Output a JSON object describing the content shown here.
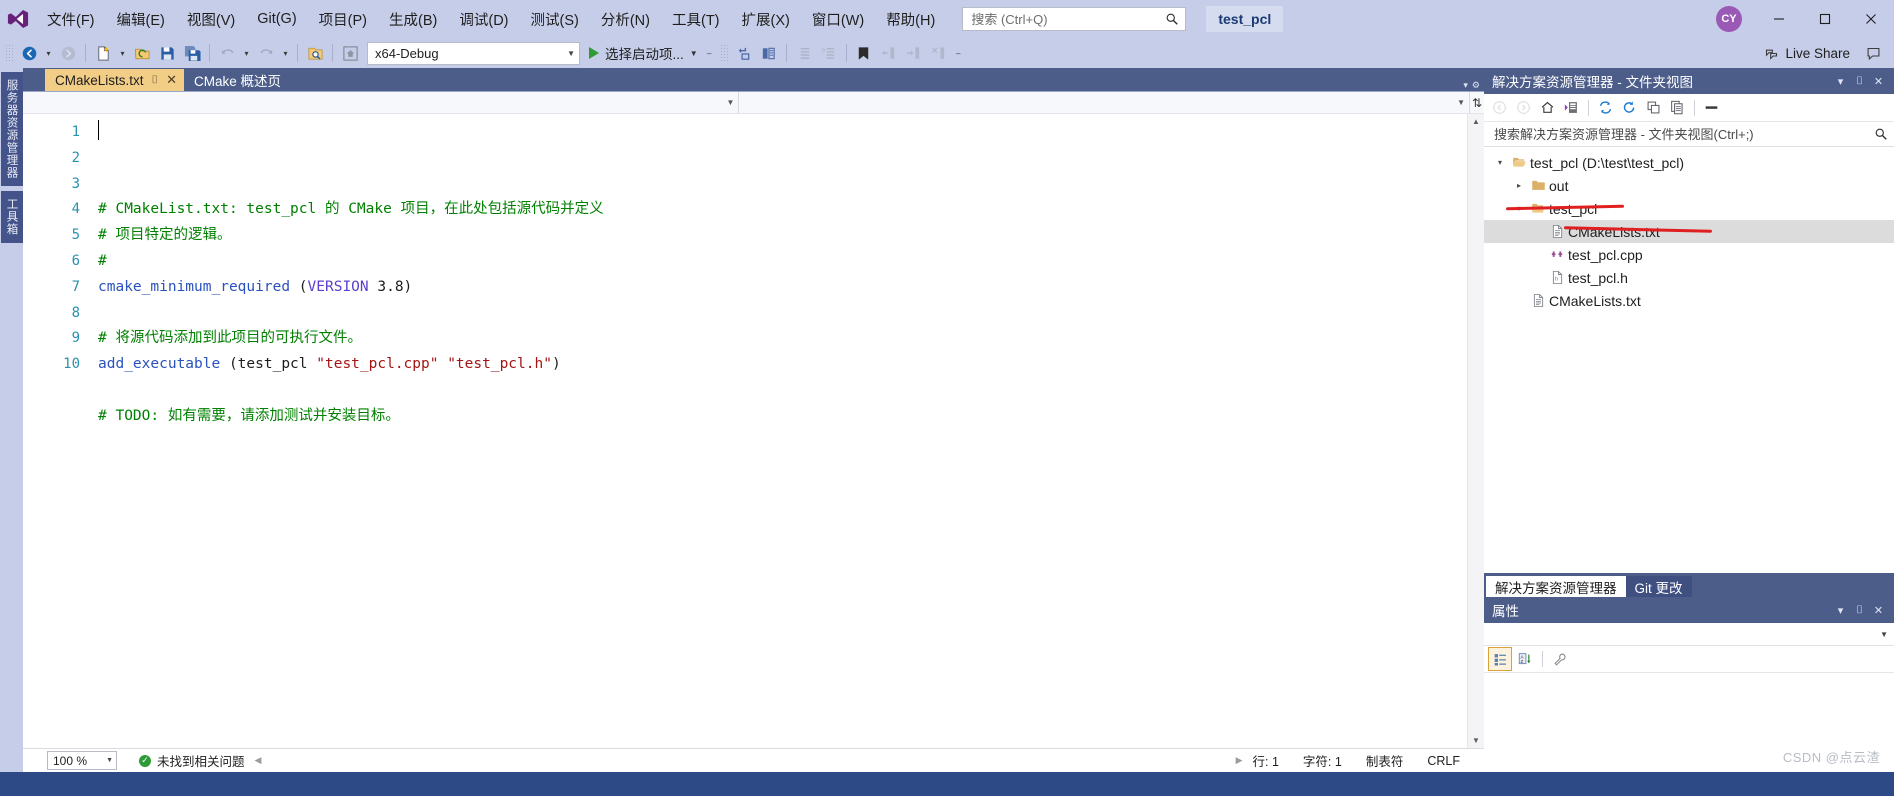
{
  "titlebar": {
    "menu": [
      "文件(F)",
      "编辑(E)",
      "视图(V)",
      "Git(G)",
      "项目(P)",
      "生成(B)",
      "调试(D)",
      "测试(S)",
      "分析(N)",
      "工具(T)",
      "扩展(X)",
      "窗口(W)",
      "帮助(H)"
    ],
    "search_placeholder": "搜索 (Ctrl+Q)",
    "search_value": "",
    "solution_name": "test_pcl",
    "avatar_initials": "CY",
    "window_minimize": "—",
    "window_maximize": "▢",
    "window_close": "✕"
  },
  "toolbar": {
    "config_value": "x64-Debug",
    "start_label": "选择启动项...",
    "live_share_label": "Live Share"
  },
  "left_rail": {
    "tabs": [
      "服务器资源管理器",
      "工具箱"
    ]
  },
  "editor": {
    "tabs": [
      {
        "label": "CMakeLists.txt",
        "active": true,
        "pin": "⌷",
        "close": "✕"
      },
      {
        "label": "CMake 概述页",
        "active": false
      }
    ],
    "nav_left_value": "",
    "nav_right_value": "",
    "line_numbers": [
      "1",
      "2",
      "3",
      "4",
      "5",
      "6",
      "7",
      "8",
      "9",
      "10"
    ],
    "code_lines": [
      [
        {
          "t": "# CMakeList.txt: test_pcl 的 CMake 项目，在此处包括源代码并定义",
          "c": "cm"
        }
      ],
      [
        {
          "t": "# 项目特定的逻辑。",
          "c": "cm"
        }
      ],
      [
        {
          "t": "#",
          "c": "cm"
        }
      ],
      [
        {
          "t": "cmake_minimum_required",
          "c": "fn"
        },
        {
          "t": " (",
          "c": "num"
        },
        {
          "t": "VERSION",
          "c": "kw"
        },
        {
          "t": " 3.8)",
          "c": "num"
        }
      ],
      [
        {
          "t": "",
          "c": "num"
        }
      ],
      [
        {
          "t": "# 将源代码添加到此项目的可执行文件。",
          "c": "cm"
        }
      ],
      [
        {
          "t": "add_executable",
          "c": "fn"
        },
        {
          "t": " (test_pcl ",
          "c": "num"
        },
        {
          "t": "\"test_pcl.cpp\"",
          "c": "str"
        },
        {
          "t": " ",
          "c": "num"
        },
        {
          "t": "\"test_pcl.h\"",
          "c": "str"
        },
        {
          "t": ")",
          "c": "num"
        }
      ],
      [
        {
          "t": "",
          "c": "num"
        }
      ],
      [
        {
          "t": "# TODO: 如有需要，请添加测试并安装目标。",
          "c": "cm"
        }
      ],
      [
        {
          "t": "",
          "c": "num"
        }
      ]
    ],
    "status": {
      "zoom": "100 %",
      "problem_text": "未找到相关问题",
      "line_label": "行: 1",
      "char_label": "字符: 1",
      "tab_label": "制表符",
      "eol_label": "CRLF"
    }
  },
  "solution_explorer": {
    "title": "解决方案资源管理器 - 文件夹视图",
    "search_placeholder": "搜索解决方案资源管理器 - 文件夹视图(Ctrl+;)",
    "search_value": "",
    "tree": [
      {
        "label": "test_pcl (D:\\test\\test_pcl)",
        "depth": 0,
        "expander": "▾",
        "icon": "folder-open-icon",
        "selected": false
      },
      {
        "label": "out",
        "depth": 1,
        "expander": "▸",
        "icon": "folder-icon",
        "selected": false
      },
      {
        "label": "test_pcl",
        "depth": 1,
        "expander": "▾",
        "icon": "folder-open-icon",
        "selected": false
      },
      {
        "label": "CMakeLists.txt",
        "depth": 2,
        "expander": "",
        "icon": "text-file-icon",
        "selected": true
      },
      {
        "label": "test_pcl.cpp",
        "depth": 2,
        "expander": "",
        "icon": "cpp-file-icon",
        "selected": false
      },
      {
        "label": "test_pcl.h",
        "depth": 2,
        "expander": "",
        "icon": "header-file-icon",
        "selected": false
      },
      {
        "label": "CMakeLists.txt",
        "depth": 1,
        "expander": "",
        "icon": "text-file-icon",
        "selected": false
      }
    ],
    "dock_tabs": [
      {
        "label": "解决方案资源管理器",
        "active": true
      },
      {
        "label": "Git 更改",
        "active": false
      }
    ]
  },
  "properties": {
    "title": "属性"
  },
  "watermark": "CSDN @点云渣",
  "colors": {
    "chrome": "#c6cde8",
    "dock": "#4c5d8a",
    "active_tab": "#f2cd86",
    "accent_blue": "#2e4a86",
    "annotation_red": "#e02020",
    "comment_green": "#008000",
    "function_blue": "#2a52be",
    "string_red": "#a31515",
    "keyword_purple": "#5c3fcf",
    "linenum_teal": "#2b91af"
  }
}
